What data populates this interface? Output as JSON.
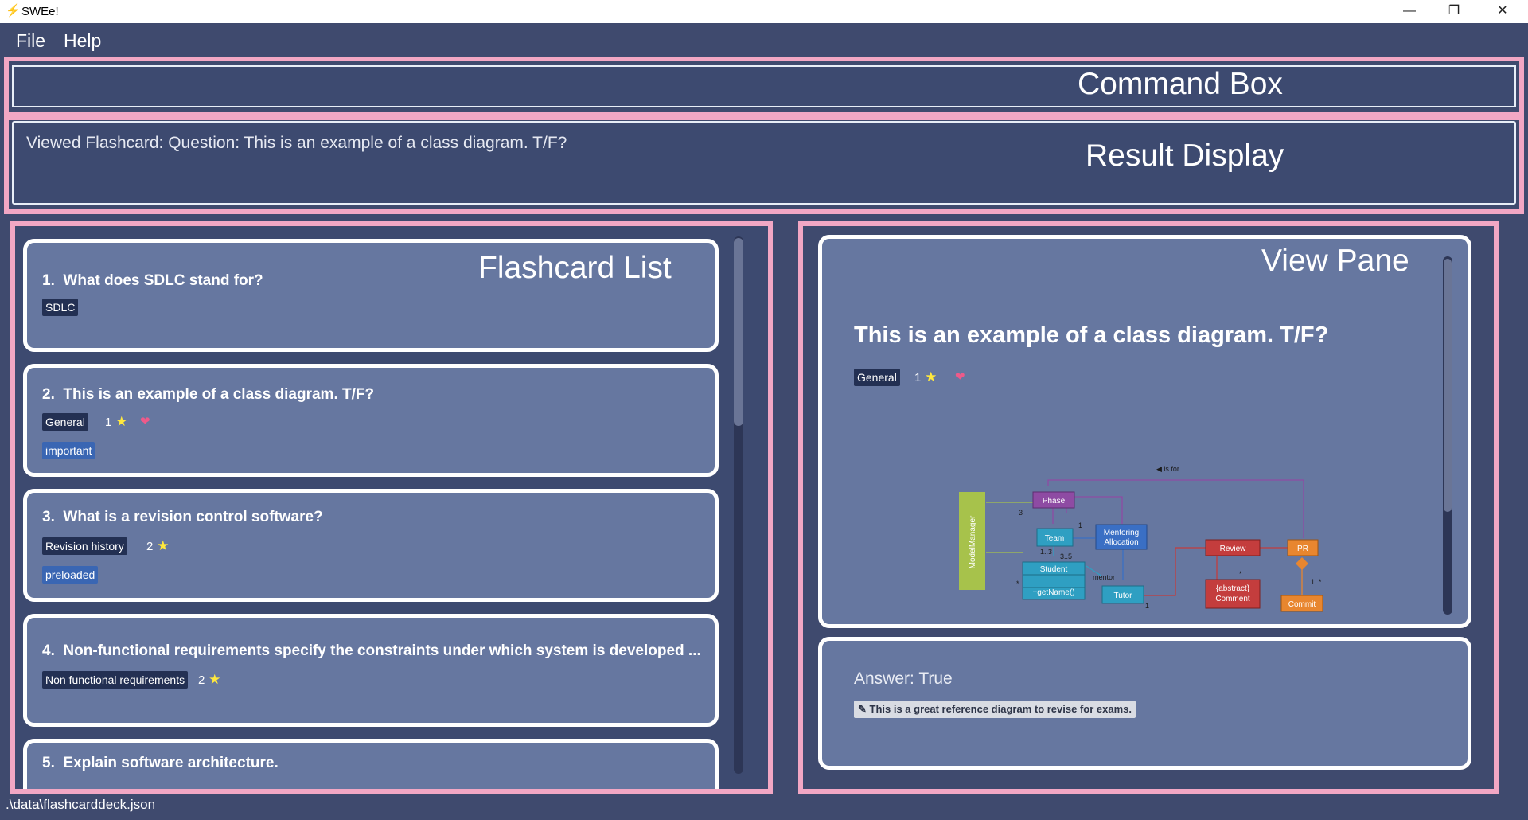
{
  "window": {
    "title": "SWEe!",
    "minimize": "—",
    "maximize": "❐",
    "close": "✕"
  },
  "menu": {
    "file": "File",
    "help": "Help"
  },
  "annotations": {
    "command_box": "Command Box",
    "result_display": "Result Display",
    "flashcard_list": "Flashcard List",
    "view_pane": "View Pane"
  },
  "result": {
    "text": "Viewed Flashcard:  Question: This is an example of a class diagram. T/F?"
  },
  "flashcards": [
    {
      "index": "1.",
      "question": "What does SDLC stand for?",
      "category": "SDLC"
    },
    {
      "index": "2.",
      "question": "This is an example of a class diagram. T/F?",
      "category": "General",
      "rating": "1",
      "tag": "important"
    },
    {
      "index": "3.",
      "question": "What is a revision control software?",
      "category": "Revision history",
      "rating": "2",
      "tag": "preloaded"
    },
    {
      "index": "4.",
      "question": "Non-functional requirements specify the constraints under which system is developed ...",
      "category": "Non functional requirements",
      "rating": "2"
    },
    {
      "index": "5.",
      "question": "Explain software architecture."
    }
  ],
  "view": {
    "question": "This is an example of a class diagram. T/F?",
    "category": "General",
    "rating": "1",
    "answer": "Answer: True",
    "note": "✎ This is a great reference diagram to revise for exams."
  },
  "diagram": {
    "model_manager": "ModelManager",
    "phase": "Phase",
    "team": "Team",
    "mentoring_1": "Mentoring",
    "mentoring_2": "Allocation",
    "student": "Student",
    "student_method": "+getName()",
    "tutor": "Tutor",
    "review": "Review",
    "comment_1": "{abstract}",
    "comment_2": "Comment",
    "pr": "PR",
    "commit": "Commit",
    "is_for": "◀ is for",
    "mentor": "mentor",
    "m_3": "3",
    "m_1a": "1",
    "m_13": "1..3",
    "m_35": "3..5",
    "m_star": "*",
    "m_1b": "1",
    "m_star2": "*",
    "m_1star": "1..*"
  },
  "status": {
    "path": ".\\data\\flashcarddeck.json"
  },
  "colors": {
    "background": "#3f4a6e",
    "card": "#6677a0",
    "annotation": "#f2a7c4",
    "star": "#ffe83d",
    "heart": "#ee5a8a"
  }
}
